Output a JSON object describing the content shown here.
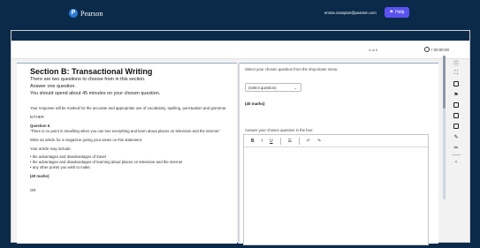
{
  "header": {
    "brand": "Pearson",
    "email": "emma.crampton@pearson.com",
    "help_label": "Help"
  },
  "toolbar": {
    "page_info": "4 of 5",
    "timer": "/ 00:00:00"
  },
  "left": {
    "title": "Section B: Transactional Writing",
    "intro": [
      "There are two questions to choose from in this section.",
      "Answer one question.",
      "You should spend about 45 minutes on your chosen question."
    ],
    "assessment": "Your response will be marked for the accurate and appropriate use of vocabulary, spelling, punctuation and grammar.",
    "either": "EITHER",
    "question_label": "Question 6",
    "question_quote": "'There is no point in travelling when you can see everything and learn about places on television and the internet.'",
    "task": "Write an article for a magazine giving your views on this statement.",
    "may_include": "Your article may include:",
    "bullets": [
      "the advantages and disadvantages of travel",
      "the advantages and disadvantages of learning about places on television and the internet",
      "any other points you wish to make."
    ],
    "marks": "(40 marks)",
    "or": "OR"
  },
  "right": {
    "select_instruction": "Select your chosen question from the drop-down menu:",
    "select_value": "(select question)",
    "marks": "(40 marks)",
    "answer_instruction": "Answer your chosen question in the box:",
    "editor_buttons": [
      "B",
      "I",
      "U",
      "☰",
      "↶",
      "↷"
    ]
  }
}
